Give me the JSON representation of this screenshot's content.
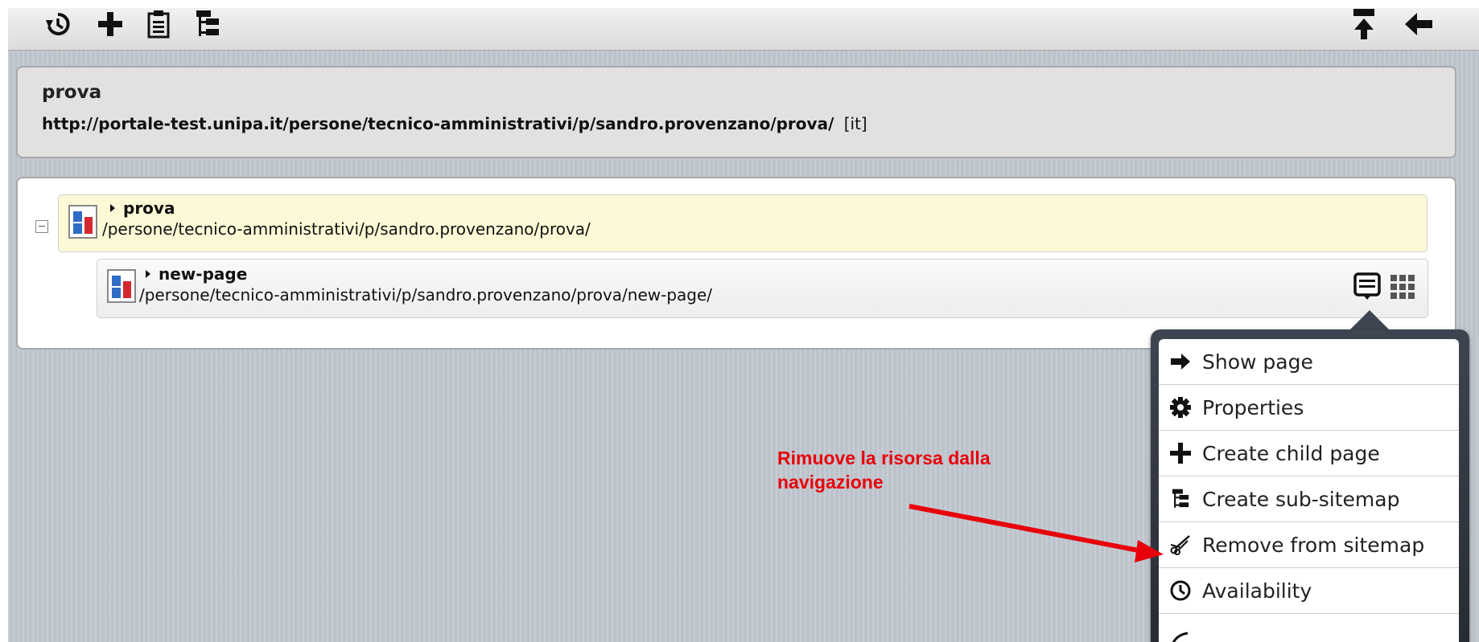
{
  "toolbar": {
    "left_icons": [
      "history-icon",
      "add-icon",
      "clipboard-icon",
      "sitemap-icon"
    ],
    "right_icons": [
      "move-up-icon",
      "back-arrow-icon"
    ]
  },
  "info": {
    "title": "prova",
    "url": "http://portale-test.unipa.it/persone/tecnico-amministrativi/p/sandro.provenzano/prova/",
    "lang": "[it]"
  },
  "tree": {
    "root": {
      "name": "prova",
      "path": "/persone/tecnico-amministrativi/p/sandro.provenzano/prova/"
    },
    "child": {
      "name": "new-page",
      "path": "/persone/tecnico-amministrativi/p/sandro.provenzano/prova/new-page/"
    }
  },
  "menu": {
    "items": [
      {
        "label": "Show page",
        "icon": "arrow-right-icon"
      },
      {
        "label": "Properties",
        "icon": "gear-icon"
      },
      {
        "label": "Create child page",
        "icon": "plus-icon"
      },
      {
        "label": "Create sub-sitemap",
        "icon": "sitemap-icon"
      },
      {
        "label": "Remove from sitemap",
        "icon": "scissors-icon"
      },
      {
        "label": "Availability",
        "icon": "clock-icon"
      }
    ]
  },
  "annotation": {
    "text": "Rimuove la risorsa dalla navigazione",
    "color": "#e8000b"
  }
}
